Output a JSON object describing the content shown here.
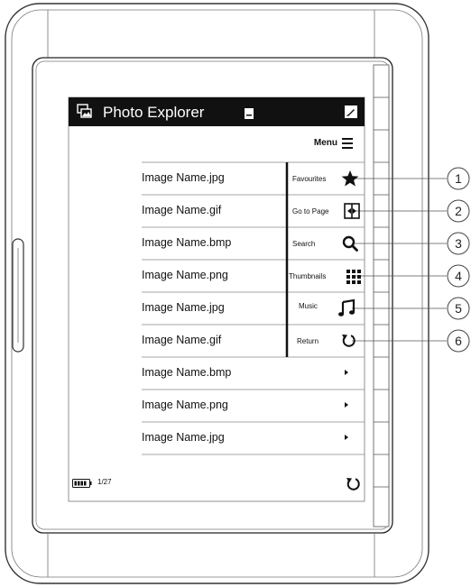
{
  "app": {
    "title": "Photo Explorer"
  },
  "header": {
    "menu_label": "Menu"
  },
  "files": [
    {
      "name": "Image Name.jpg"
    },
    {
      "name": "Image Name.gif"
    },
    {
      "name": "Image Name.bmp"
    },
    {
      "name": "Image Name.png"
    },
    {
      "name": "Image Name.jpg"
    },
    {
      "name": "Image Name.gif"
    },
    {
      "name": "Image Name.bmp"
    },
    {
      "name": "Image Name.png"
    },
    {
      "name": "Image Name.jpg"
    }
  ],
  "menu_options": [
    {
      "label": "Favourites",
      "icon": "star-icon",
      "callout": "1"
    },
    {
      "label": "Go to Page",
      "icon": "goto-page-icon",
      "callout": "2"
    },
    {
      "label": "Search",
      "icon": "search-icon",
      "callout": "3"
    },
    {
      "label": "Thumbnails",
      "icon": "thumbnails-icon",
      "callout": "4"
    },
    {
      "label": "Music",
      "icon": "music-note-icon",
      "callout": "5"
    },
    {
      "label": "Return",
      "icon": "return-icon",
      "callout": "6"
    }
  ],
  "status": {
    "page": "1/27"
  }
}
